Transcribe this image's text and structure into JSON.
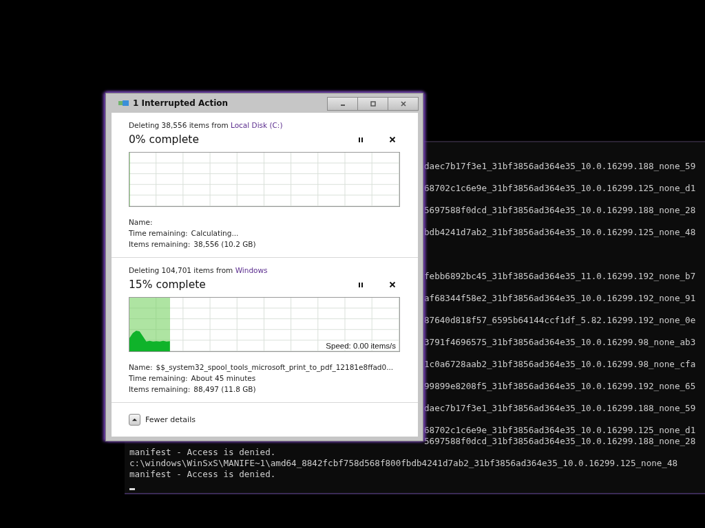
{
  "terminal": {
    "fragments_before_gap": [
      "daec7b17f3e1_31bf3856ad364e35_10.0.16299.188_none_59",
      "68702c1c6e9e_31bf3856ad364e35_10.0.16299.125_none_d1",
      "5697588f0dcd_31bf3856ad364e35_10.0.16299.188_none_28",
      "bdb4241d7ab2_31bf3856ad364e35_10.0.16299.125_none_48"
    ],
    "fragments_after_gap": [
      "febb6892bc45_31bf3856ad364e35_11.0.16299.192_none_b7",
      "af68344f58e2_31bf3856ad364e35_10.0.16299.192_none_91",
      "87640d818f57_6595b64144ccf1df_5.82.16299.192_none_0e",
      "3791f4696575_31bf3856ad364e35_10.0.16299.98_none_ab3",
      "1c0a6728aab2_31bf3856ad364e35_10.0.16299.98_none_cfa",
      "99899e8208f5_31bf3856ad364e35_10.0.16299.192_none_65",
      "daec7b17f3e1_31bf3856ad364e35_10.0.16299.188_none_59",
      "68702c1c6e9e_31bf3856ad364e35_10.0.16299.125_none_d1"
    ],
    "partial_line": "5697588f0dcd_31bf3856ad364e35_10.0.16299.188_none_28",
    "lines": [
      "manifest - Access is denied.",
      "c:\\windows\\WinSxS\\MANIFE~1\\amd64_8842fcbf758d568f800fbdb4241d7ab2_31bf3856ad364e35_10.0.16299.125_none_48",
      "manifest - Access is denied."
    ]
  },
  "dialog": {
    "title": "1 Interrupted Action",
    "operations": [
      {
        "summary": "Deleting 38,556 items from ",
        "source": "Local Disk (C:)",
        "percent": "0% complete",
        "level": 0,
        "details": [
          {
            "label": "Name:"
          },
          {
            "label": "Time remaining:",
            "value": "Calculating..."
          },
          {
            "label": "Items remaining:",
            "value": "38,556 (10.2 GB)"
          }
        ]
      },
      {
        "summary": "Deleting 104,701 items from ",
        "source": "Windows",
        "percent": "15% complete",
        "level": 0.15,
        "speed": "Speed: 0.00 items/s",
        "details": [
          {
            "label": "Name:",
            "value": "$$_system32_spool_tools_microsoft_print_to_pdf_12181e8ffad0..."
          },
          {
            "label": "Time remaining:",
            "value": "About 45 minutes"
          },
          {
            "label": "Items remaining:",
            "value": "88,497 (11.8 GB)"
          }
        ]
      }
    ],
    "footer": {
      "label": "Fewer details",
      "expanded": true
    }
  }
}
